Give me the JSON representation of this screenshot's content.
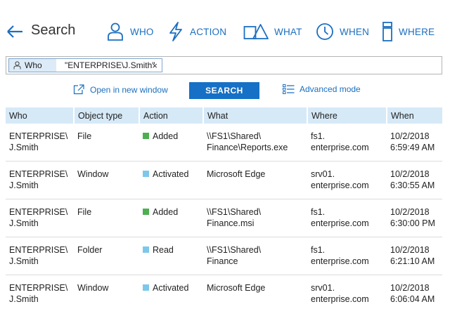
{
  "header": {
    "title": "Search",
    "filters": [
      {
        "label": "WHO",
        "icon": "person-icon"
      },
      {
        "label": "ACTION",
        "icon": "lightning-icon"
      },
      {
        "label": "WHAT",
        "icon": "shapes-icon"
      },
      {
        "label": "WHEN",
        "icon": "clock-icon"
      },
      {
        "label": "WHERE",
        "icon": "server-icon"
      }
    ]
  },
  "search": {
    "chip_key": "Who",
    "chip_value": "\"ENTERPRISE\\J.Smith\"",
    "remove_glyph": "×"
  },
  "actions": {
    "open_new_window": "Open in new window",
    "search_button": "SEARCH",
    "advanced_mode": "Advanced mode"
  },
  "colors": {
    "accent": "#1570c6",
    "header_bg": "#d6e9f7",
    "added": "#4caf50",
    "activated": "#7cc8ea",
    "read": "#7cc8ea"
  },
  "table": {
    "columns": [
      "Who",
      "Object type",
      "Action",
      "What",
      "Where",
      "When"
    ],
    "rows": [
      {
        "who": [
          "ENTERPRISE\\",
          "J.Smith"
        ],
        "type": "File",
        "action": "Added",
        "action_color": "#4caf50",
        "what": [
          "\\\\FS1\\Shared\\",
          "Finance\\Reports.exe"
        ],
        "where": [
          "fs1.",
          "enterprise.com"
        ],
        "when": [
          "10/2/2018",
          "6:59:49 AM"
        ]
      },
      {
        "who": [
          "ENTERPRISE\\",
          "J.Smith"
        ],
        "type": "Window",
        "action": "Activated",
        "action_color": "#7cc8ea",
        "what": [
          "Microsoft Edge",
          ""
        ],
        "where": [
          "srv01.",
          "enterprise.com"
        ],
        "when": [
          "10/2/2018",
          "6:30:55 AM"
        ]
      },
      {
        "who": [
          "ENTERPRISE\\",
          "J.Smith"
        ],
        "type": "File",
        "action": "Added",
        "action_color": "#4caf50",
        "what": [
          "\\\\FS1\\Shared\\",
          "Finance.msi"
        ],
        "where": [
          "fs1.",
          "enterprise.com"
        ],
        "when": [
          "10/2/2018",
          "6:30:00 PM"
        ]
      },
      {
        "who": [
          "ENTERPRISE\\",
          "J.Smith"
        ],
        "type": "Folder",
        "action": "Read",
        "action_color": "#7cc8ea",
        "what": [
          "\\\\FS1\\Shared\\",
          "Finance"
        ],
        "where": [
          "fs1.",
          "enterprise.com"
        ],
        "when": [
          "10/2/2018",
          "6:21:10 AM"
        ]
      },
      {
        "who": [
          "ENTERPRISE\\",
          "J.Smith"
        ],
        "type": "Window",
        "action": "Activated",
        "action_color": "#7cc8ea",
        "what": [
          "Microsoft Edge",
          ""
        ],
        "where": [
          "srv01.",
          "enterprise.com"
        ],
        "when": [
          "10/2/2018",
          "6:06:04 AM"
        ]
      }
    ]
  }
}
